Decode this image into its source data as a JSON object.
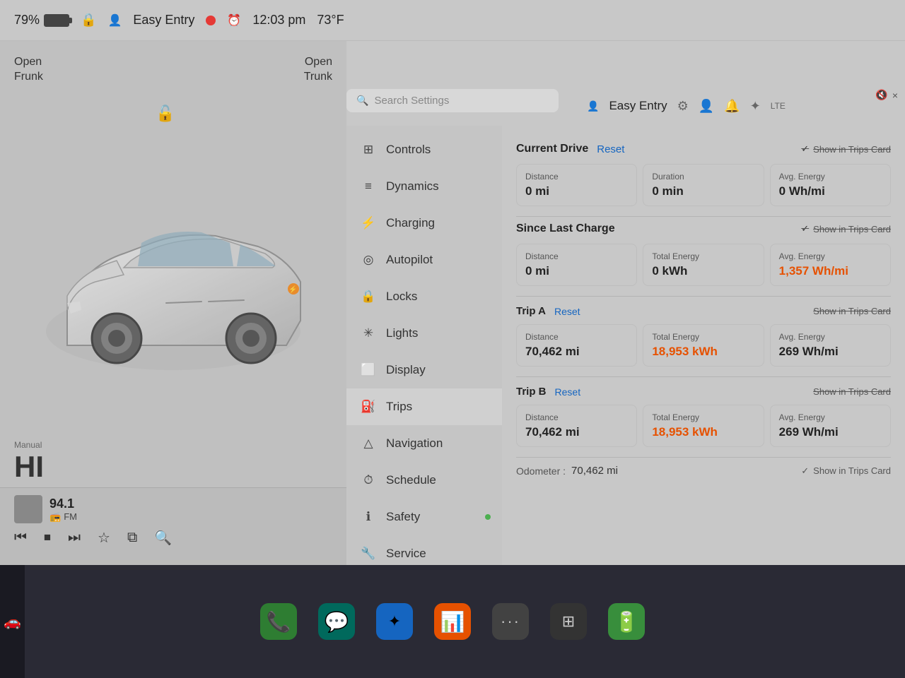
{
  "statusBar": {
    "battery_percent": "79%",
    "lock_icon": "🔒",
    "person_icon": "👤",
    "easy_entry": "Easy Entry",
    "recording_color": "#e53935",
    "alarm_icon": "⏰",
    "time": "12:03 pm",
    "temp": "73°F"
  },
  "leftPanel": {
    "open_frunk": "Open\nFrunk",
    "open_trunk": "Open\nTrunk",
    "music_station": "94.1",
    "music_type": "FM",
    "music_type_icon": "📻"
  },
  "search": {
    "placeholder": "Search Settings"
  },
  "rightHeader": {
    "person_icon": "👤",
    "title": "Easy Entry",
    "settings_icon": "⚙",
    "profile_icon": "👤",
    "bell_icon": "🔔",
    "bluetooth_icon": "⬡",
    "wifi_icon": "≋"
  },
  "menu": {
    "items": [
      {
        "id": "controls",
        "icon": "⊞",
        "label": "Controls",
        "dot": false
      },
      {
        "id": "dynamics",
        "icon": "≡",
        "label": "Dynamics",
        "dot": false
      },
      {
        "id": "charging",
        "icon": "⚡",
        "label": "Charging",
        "dot": false
      },
      {
        "id": "autopilot",
        "icon": "◎",
        "label": "Autopilot",
        "dot": false
      },
      {
        "id": "locks",
        "icon": "🔒",
        "label": "Locks",
        "dot": false
      },
      {
        "id": "lights",
        "icon": "✳",
        "label": "Lights",
        "dot": false
      },
      {
        "id": "display",
        "icon": "⬜",
        "label": "Display",
        "dot": false
      },
      {
        "id": "trips",
        "icon": "⛽",
        "label": "Trips",
        "dot": false
      },
      {
        "id": "navigation",
        "icon": "△",
        "label": "Navigation",
        "dot": false
      },
      {
        "id": "schedule",
        "icon": "⏱",
        "label": "Schedule",
        "dot": false
      },
      {
        "id": "safety",
        "icon": "ℹ",
        "label": "Safety",
        "dot": true
      },
      {
        "id": "service",
        "icon": "🔧",
        "label": "Service",
        "dot": false
      }
    ]
  },
  "tripsPanel": {
    "currentDrive": {
      "title": "Current Drive",
      "reset": "Reset",
      "show_trips": "Show in Trips Card",
      "distance_label": "Distance",
      "distance_value": "0 mi",
      "duration_label": "Duration",
      "duration_value": "0 min",
      "avg_energy_label": "Avg. Energy",
      "avg_energy_value": "0 Wh/mi"
    },
    "sinceLastCharge": {
      "title": "Since Last Charge",
      "show_trips": "Show in Trips Card",
      "distance_label": "Distance",
      "distance_value": "0 mi",
      "total_energy_label": "Total Energy",
      "total_energy_value": "0 kWh",
      "avg_energy_label": "Avg. Energy",
      "avg_energy_value": "1,357 Wh/mi"
    },
    "tripA": {
      "title": "Trip A",
      "reset": "Reset",
      "show_trips": "Show in Trips Card",
      "distance_label": "Distance",
      "distance_value": "70,462 mi",
      "total_energy_label": "Total Energy",
      "total_energy_value": "18,953 kWh",
      "avg_energy_label": "Avg. Energy",
      "avg_energy_value": "269 Wh/mi"
    },
    "tripB": {
      "title": "Trip B",
      "reset": "Reset",
      "show_trips": "Show in Trips Card",
      "distance_label": "Distance",
      "distance_value": "70,462 mi",
      "total_energy_label": "Total Energy",
      "total_energy_value": "18,953 kWh",
      "avg_energy_label": "Avg. Energy",
      "avg_energy_value": "269 Wh/mi"
    },
    "odometer": {
      "label": "Odometer :",
      "value": "70,462 mi",
      "show_trips": "Show in Trips Card"
    }
  },
  "taskbar": {
    "items": [
      {
        "id": "phone",
        "color": "green",
        "icon": "📞"
      },
      {
        "id": "messages",
        "color": "teal",
        "icon": "💬"
      },
      {
        "id": "bluetooth",
        "color": "blue",
        "icon": "⬡"
      },
      {
        "id": "chart",
        "color": "orange",
        "icon": "📊"
      },
      {
        "id": "dots",
        "color": "gray",
        "icon": "···"
      },
      {
        "id": "table",
        "color": "dark",
        "icon": "⊞"
      },
      {
        "id": "battery2",
        "color": "green2",
        "icon": "🔋"
      }
    ]
  },
  "gear": {
    "mode": "Manual",
    "value": "HI"
  },
  "volume": {
    "icon": "🔇",
    "close": "×"
  }
}
